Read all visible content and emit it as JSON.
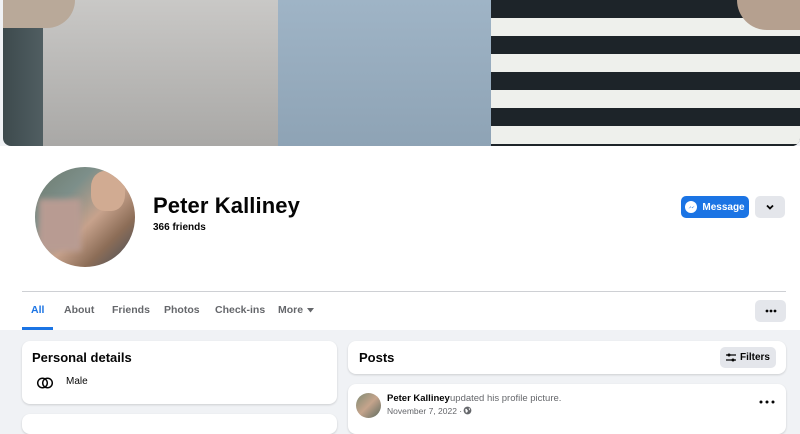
{
  "profile": {
    "name": "Peter Kalliney",
    "friends": "366 friends",
    "message_label": "Message"
  },
  "tabs": [
    {
      "label": "All",
      "active": true
    },
    {
      "label": "About"
    },
    {
      "label": "Friends"
    },
    {
      "label": "Photos"
    },
    {
      "label": "Check-ins"
    },
    {
      "label": "More"
    }
  ],
  "personal_details": {
    "title": "Personal details",
    "items": [
      {
        "icon": "gender-icon",
        "text": "Male"
      }
    ]
  },
  "posts": {
    "title": "Posts",
    "filters_label": "Filters",
    "items": [
      {
        "author": "Peter Kalliney",
        "action": "updated his profile picture.",
        "date": "November 7, 2022 ·",
        "privacy_icon": "globe-icon"
      }
    ]
  },
  "colors": {
    "accent": "#1b74e4",
    "background": "#f0f2f5",
    "button_grey": "#e4e6eb",
    "secondary_text": "#65676b"
  }
}
